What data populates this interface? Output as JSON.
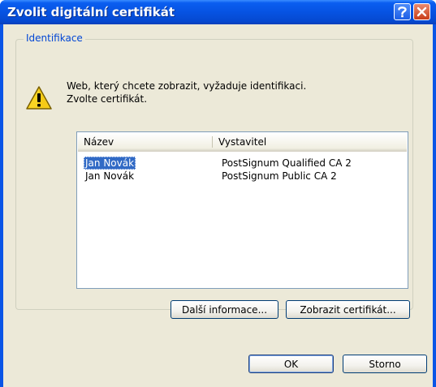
{
  "window": {
    "title": "Zvolit digitální certifikát"
  },
  "group": {
    "label": "Identifikace"
  },
  "message": {
    "line1": "Web, který chcete zobrazit, vyžaduje identifikaci.",
    "line2": "Zvolte certifikát."
  },
  "table": {
    "columns": [
      "Název",
      "Vystavitel"
    ],
    "rows": [
      {
        "name": "Jan Novák",
        "issuer": "PostSignum Qualified CA 2",
        "selected": true
      },
      {
        "name": "Jan Novák",
        "issuer": "PostSignum Public CA 2",
        "selected": false
      }
    ]
  },
  "buttons": {
    "more_info": "Další informace...",
    "view_cert": "Zobrazit certifikát...",
    "ok": "OK",
    "cancel": "Storno"
  },
  "icons": {
    "help": "help-icon",
    "close": "close-icon",
    "warning": "warning-icon"
  },
  "colors": {
    "titlebar": "#0653e2",
    "dialog_bg": "#ece9d8",
    "selection": "#316ac5",
    "group_label": "#0046d5"
  }
}
